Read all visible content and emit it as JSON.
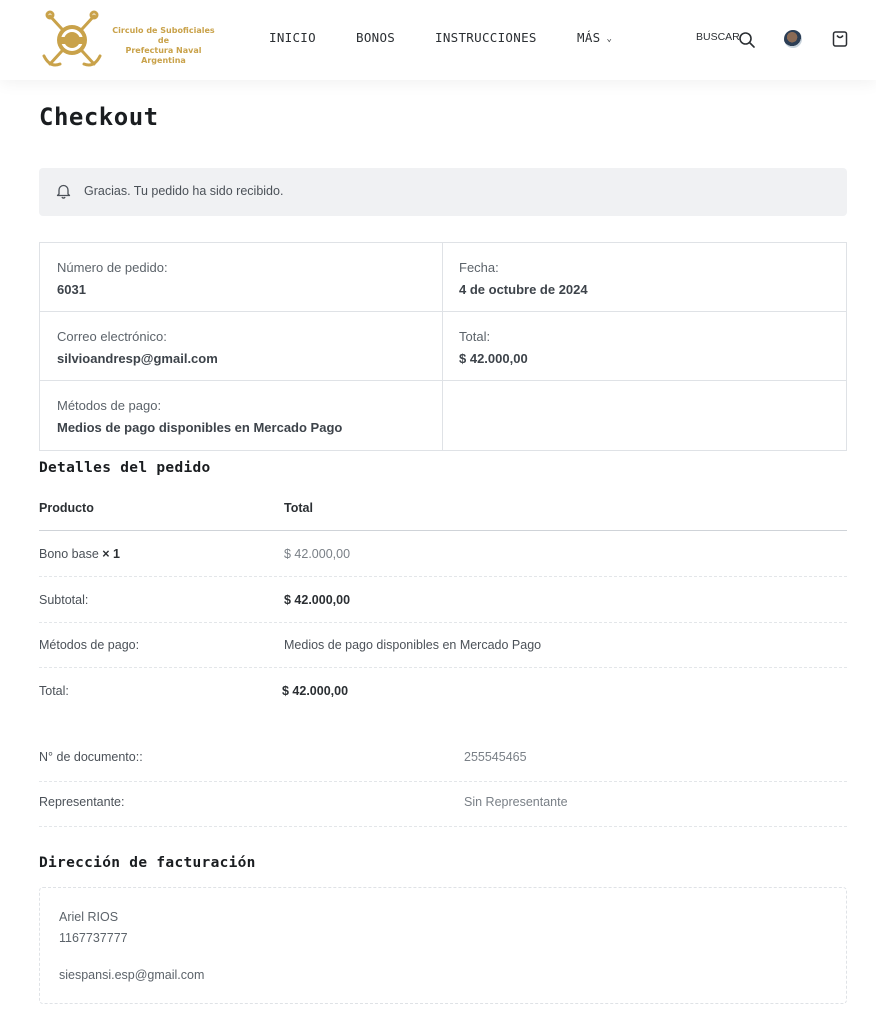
{
  "header": {
    "logo_text_line1": "Circulo de Suboficiales de",
    "logo_text_line2": "Prefectura Naval Argentina",
    "nav": [
      "INICIO",
      "BONOS",
      "INSTRUCCIONES",
      "MÁS"
    ],
    "search_label": "BUSCAR",
    "icons": [
      "search-icon",
      "avatar",
      "cart-icon",
      "chevron-down-icon"
    ]
  },
  "page": {
    "title": "Checkout"
  },
  "notice": {
    "text": "Gracias. Tu pedido ha sido recibido.",
    "icon": "bell-icon"
  },
  "overview": {
    "order_number_label": "Número de pedido:",
    "order_number": "6031",
    "date_label": "Fecha:",
    "date": "4 de octubre de 2024",
    "email_label": "Correo electrónico:",
    "email": "silvioandresp@gmail.com",
    "total_label": "Total:",
    "total": "$ 42.000,00",
    "payment_label": "Métodos de pago:",
    "payment": "Medios de pago disponibles en Mercado Pago"
  },
  "details": {
    "title": "Detalles del pedido",
    "col_product": "Producto",
    "col_total": "Total",
    "rows": [
      {
        "label": "Bono base",
        "qty": "× 1",
        "value": "$ 42.000,00"
      },
      {
        "label": "Subtotal:",
        "value": "$ 42.000,00"
      },
      {
        "label": "Métodos de pago:",
        "value": "Medios de pago disponibles en Mercado Pago"
      },
      {
        "label": "Total:",
        "value": "$ 42.000,00"
      }
    ]
  },
  "meta": [
    {
      "label": "N° de documento::",
      "value": "255545465"
    },
    {
      "label": "Representante:",
      "value": "Sin Representante"
    }
  ],
  "billing": {
    "title": "Dirección de facturación",
    "name": "Ariel RIOS",
    "phone": "1167737777",
    "email": "siespansi.esp@gmail.com"
  },
  "colors": {
    "brand_gold": "#c9a24a",
    "notice_bg": "#f0f1f3",
    "border": "#dfe2e6"
  }
}
